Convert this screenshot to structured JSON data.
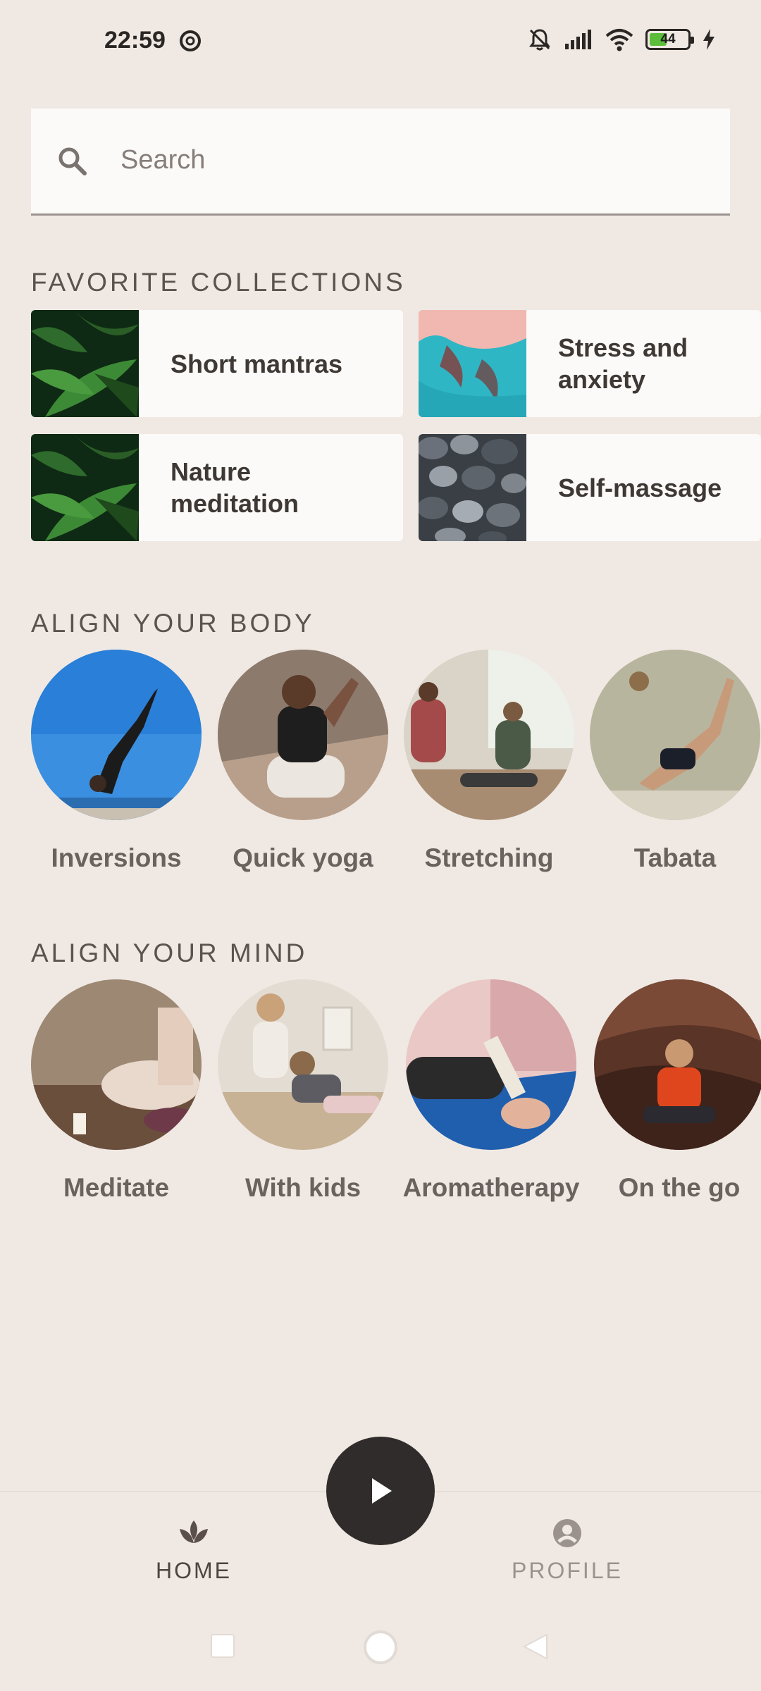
{
  "status_bar": {
    "time": "22:59",
    "battery": "44"
  },
  "search": {
    "placeholder": "Search"
  },
  "favorites": {
    "title": "FAVORITE COLLECTIONS",
    "items": [
      {
        "label": "Short mantras",
        "thumb": "leaves"
      },
      {
        "label": "Stress and anxiety",
        "thumb": "sea"
      },
      {
        "label": "Nature meditation",
        "thumb": "leaves"
      },
      {
        "label": "Self-massage",
        "thumb": "pebbles"
      }
    ]
  },
  "body": {
    "title": "ALIGN YOUR BODY",
    "items": [
      {
        "label": "Inversions"
      },
      {
        "label": "Quick yoga"
      },
      {
        "label": "Stretching"
      },
      {
        "label": "Tabata"
      }
    ]
  },
  "mind": {
    "title": "ALIGN YOUR MIND",
    "items": [
      {
        "label": "Meditate"
      },
      {
        "label": "With kids"
      },
      {
        "label": "Aromatherapy"
      },
      {
        "label": "On the go"
      }
    ]
  },
  "nav": {
    "home": "HOME",
    "profile": "PROFILE"
  },
  "colors": {
    "background": "#F0E9E3",
    "card": "#FCFAF8",
    "play": "#2F2C2B"
  }
}
